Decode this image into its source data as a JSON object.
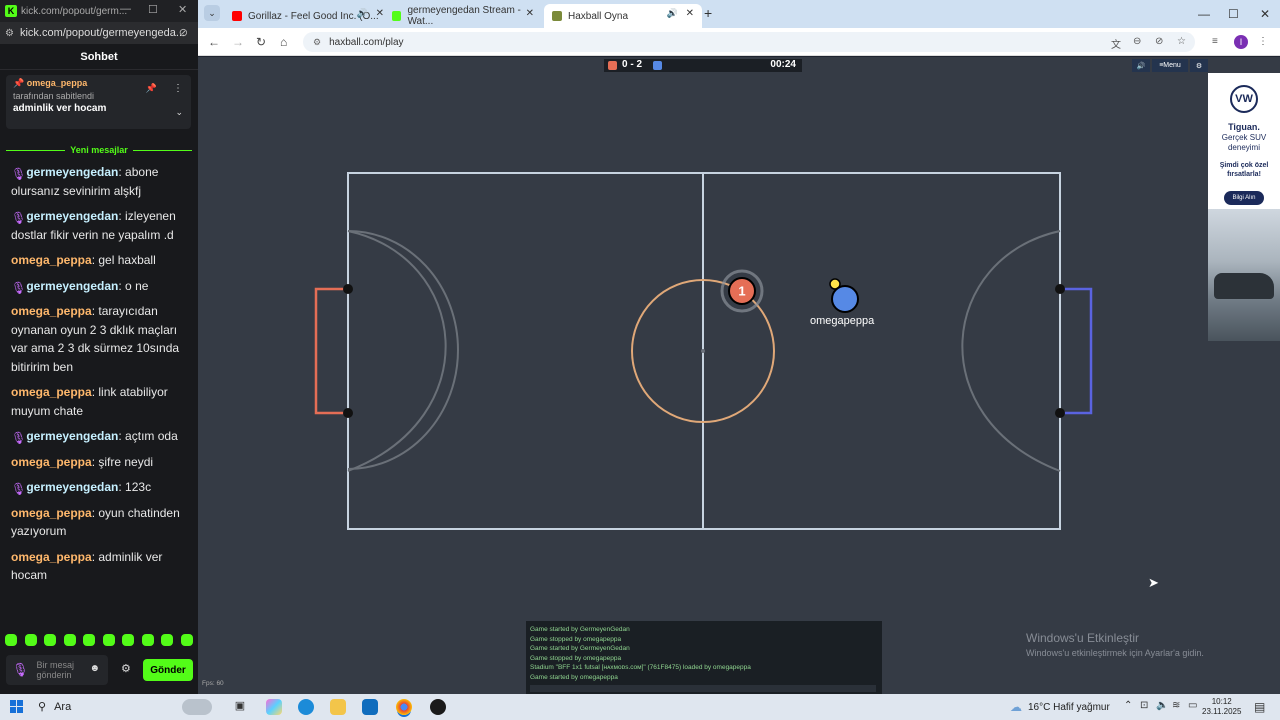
{
  "kick_window": {
    "title": "kick.com/popout/germ...",
    "url": "kick.com/popout/germeyengeda...",
    "chat_header": "Sohbet",
    "pinned": {
      "user": "omega_peppa",
      "subtitle": "tarafından sabitlendi",
      "message": "adminlik ver hocam"
    },
    "new_messages_label": "Yeni mesajlar",
    "messages": [
      {
        "user": "germeyengedan",
        "text": ": abone olursanız sevinirim alşkfj",
        "kind": "streamer"
      },
      {
        "user": "germeyengedan",
        "text": ": izleyenen dostlar fikir verin ne yapalım .d",
        "kind": "streamer"
      },
      {
        "user": "omega_peppa",
        "text": ": gel haxball",
        "kind": "viewer"
      },
      {
        "user": "germeyengedan",
        "text": ": o ne",
        "kind": "streamer"
      },
      {
        "user": "omega_peppa",
        "text": ": tarayıcıdan oynanan oyun 2 3 dklık maçları var ama 2 3 dk sürmez 10sında bitiririm ben",
        "kind": "viewer"
      },
      {
        "user": "omega_peppa",
        "text": ": link atabiliyor muyum chate",
        "kind": "viewer"
      },
      {
        "user": "germeyengedan",
        "text": ": açtım oda",
        "kind": "streamer"
      },
      {
        "user": "omega_peppa",
        "text": ": şifre neydi",
        "kind": "viewer"
      },
      {
        "user": "germeyengedan",
        "text": ": 123c",
        "kind": "streamer"
      },
      {
        "user": "omega_peppa",
        "text": ": oyun chatinden yazıyorum",
        "kind": "viewer"
      },
      {
        "user": "omega_peppa",
        "text": ": adminlik ver hocam",
        "kind": "viewer"
      }
    ],
    "input_placeholder": "Bir mesaj gönderin",
    "send_label": "Gönder"
  },
  "browser": {
    "tabs": [
      {
        "label": "Gorillaz - Feel Good Inc. (O...",
        "color": "#ff0000"
      },
      {
        "label": "germeyengedan Stream - Wat...",
        "color": "#53fc18"
      },
      {
        "label": "Haxball Oyna",
        "color": "#7b8a3a"
      }
    ],
    "url": "haxball.com/play"
  },
  "game": {
    "score": "0 - 2",
    "time": "00:24",
    "red_player_number": "1",
    "blue_player_name": "omegapeppa",
    "menu_label": "Menu",
    "fps": "Fps: 60",
    "log": [
      "Game started by GermeyenGedan",
      "Game stopped by omegapeppa",
      "Game started by GermeyenGedan",
      "Game stopped by omegapeppa",
      "Stadium \"BFF 1x1 futsal [ʜᴀxᴍᴏᴅs.ᴄᴏᴍ]\" (761F8475) loaded by omegapeppa",
      "Game started by omegapeppa"
    ],
    "colors": {
      "red": "#e56e56",
      "blue": "#5689e5",
      "field": "#353b45"
    }
  },
  "ad": {
    "brand": "VW",
    "title": "Tiguan.",
    "subtitle": "Gerçek SUV deneyimi",
    "offer": "Şimdi çok özel fırsatlarla!",
    "cta": "Bilgi Alın"
  },
  "watermark": {
    "title": "Windows'u Etkinleştir",
    "subtitle": "Windows'u etkinleştirmek için Ayarlar'a gidin."
  },
  "taskbar": {
    "search": "Ara",
    "weather": "16°C  Hafif yağmur",
    "time": "10:12",
    "date": "23.11.2025"
  }
}
